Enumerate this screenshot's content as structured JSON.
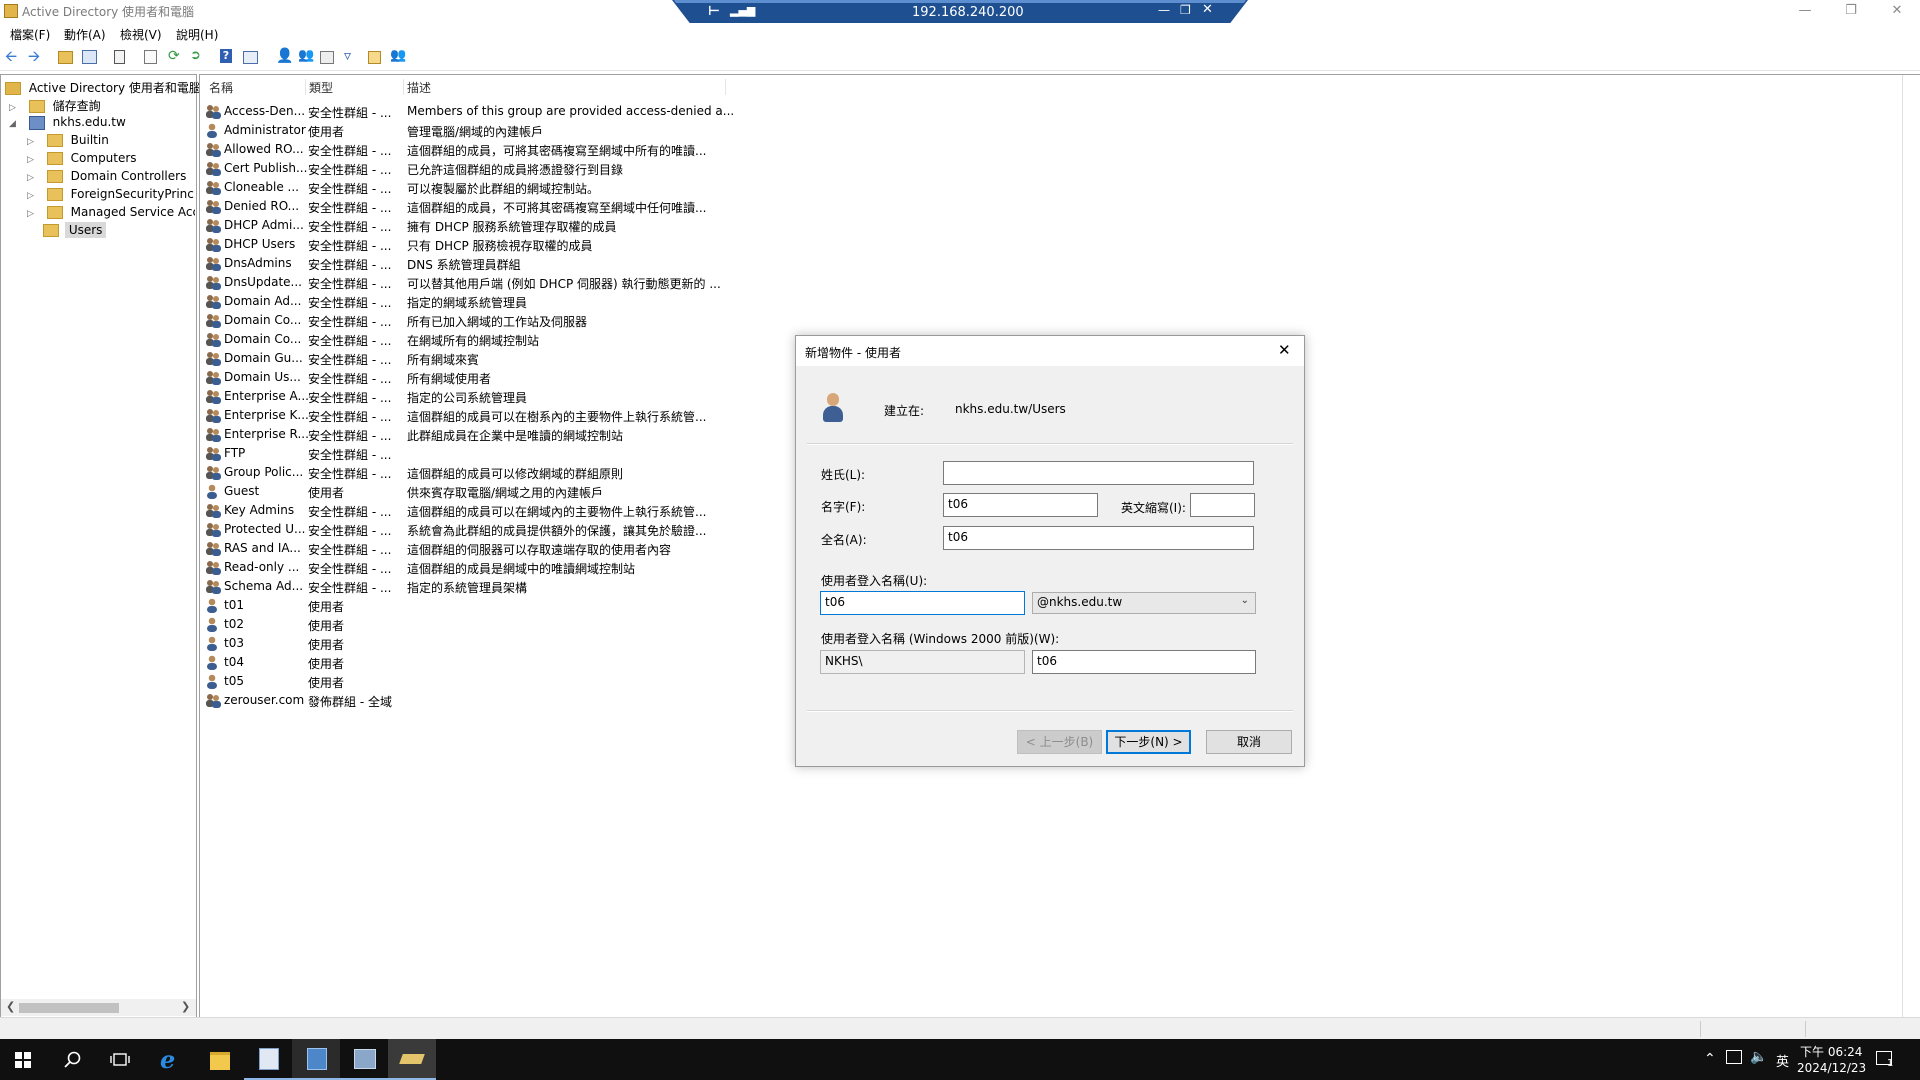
{
  "window": {
    "title": "Active Directory 使用者和電腦"
  },
  "rdp": {
    "ip": "192.168.240.200"
  },
  "menu": [
    "檔案(F)",
    "動作(A)",
    "檢視(V)",
    "說明(H)"
  ],
  "tree": {
    "root": "Active Directory 使用者和電腦",
    "saved_queries": "儲存查詢",
    "domain": "nkhs.edu.tw",
    "children": [
      "Builtin",
      "Computers",
      "Domain Controllers",
      "ForeignSecurityPrincipals",
      "Managed Service Accounts",
      "Users"
    ]
  },
  "list": {
    "headers": [
      "名稱",
      "類型",
      "描述"
    ],
    "rows": [
      {
        "name": "Access-Den...",
        "type": "安全性群組 - ...",
        "desc": "Members of this group are provided access-denied a...",
        "icon": "group"
      },
      {
        "name": "Administrator",
        "type": "使用者",
        "desc": "管理電腦/網域的內建帳戶",
        "icon": "user"
      },
      {
        "name": "Allowed RO...",
        "type": "安全性群組 - ...",
        "desc": "這個群組的成員，可將其密碼複寫至網域中所有的唯讀...",
        "icon": "group"
      },
      {
        "name": "Cert Publish...",
        "type": "安全性群組 - ...",
        "desc": "已允許這個群組的成員將憑證發行到目錄",
        "icon": "group"
      },
      {
        "name": "Cloneable ...",
        "type": "安全性群組 - ...",
        "desc": "可以複製屬於此群組的網域控制站。",
        "icon": "group"
      },
      {
        "name": "Denied RO...",
        "type": "安全性群組 - ...",
        "desc": "這個群組的成員，不可將其密碼複寫至網域中任何唯讀...",
        "icon": "group"
      },
      {
        "name": "DHCP Admi...",
        "type": "安全性群組 - ...",
        "desc": "擁有 DHCP 服務系統管理存取權的成員",
        "icon": "group"
      },
      {
        "name": "DHCP Users",
        "type": "安全性群組 - ...",
        "desc": "只有 DHCP 服務檢視存取權的成員",
        "icon": "group"
      },
      {
        "name": "DnsAdmins",
        "type": "安全性群組 - ...",
        "desc": "DNS 系統管理員群組",
        "icon": "group"
      },
      {
        "name": "DnsUpdate...",
        "type": "安全性群組 - ...",
        "desc": "可以替其他用戶端 (例如 DHCP 伺服器) 執行動態更新的 ...",
        "icon": "group"
      },
      {
        "name": "Domain Ad...",
        "type": "安全性群組 - ...",
        "desc": "指定的網域系統管理員",
        "icon": "group"
      },
      {
        "name": "Domain Co...",
        "type": "安全性群組 - ...",
        "desc": "所有已加入網域的工作站及伺服器",
        "icon": "group"
      },
      {
        "name": "Domain Co...",
        "type": "安全性群組 - ...",
        "desc": "在網域所有的網域控制站",
        "icon": "group"
      },
      {
        "name": "Domain Gu...",
        "type": "安全性群組 - ...",
        "desc": "所有網域來賓",
        "icon": "group"
      },
      {
        "name": "Domain Us...",
        "type": "安全性群組 - ...",
        "desc": "所有網域使用者",
        "icon": "group"
      },
      {
        "name": "Enterprise A...",
        "type": "安全性群組 - ...",
        "desc": "指定的公司系統管理員",
        "icon": "group"
      },
      {
        "name": "Enterprise K...",
        "type": "安全性群組 - ...",
        "desc": "這個群組的成員可以在樹系內的主要物件上執行系統管...",
        "icon": "group"
      },
      {
        "name": "Enterprise R...",
        "type": "安全性群組 - ...",
        "desc": "此群組成員在企業中是唯讀的網域控制站",
        "icon": "group"
      },
      {
        "name": "FTP",
        "type": "安全性群組 - ...",
        "desc": "",
        "icon": "group"
      },
      {
        "name": "Group Polic...",
        "type": "安全性群組 - ...",
        "desc": "這個群組的成員可以修改網域的群組原則",
        "icon": "group"
      },
      {
        "name": "Guest",
        "type": "使用者",
        "desc": "供來賓存取電腦/網域之用的內建帳戶",
        "icon": "user"
      },
      {
        "name": "Key Admins",
        "type": "安全性群組 - ...",
        "desc": "這個群組的成員可以在網域內的主要物件上執行系統管...",
        "icon": "group"
      },
      {
        "name": "Protected U...",
        "type": "安全性群組 - ...",
        "desc": "系統會為此群組的成員提供額外的保護，讓其免於驗證...",
        "icon": "group"
      },
      {
        "name": "RAS and IA...",
        "type": "安全性群組 - ...",
        "desc": "這個群組的伺服器可以存取遠端存取的使用者內容",
        "icon": "group"
      },
      {
        "name": "Read-only ...",
        "type": "安全性群組 - ...",
        "desc": "這個群組的成員是網域中的唯讀網域控制站",
        "icon": "group"
      },
      {
        "name": "Schema Ad...",
        "type": "安全性群組 - ...",
        "desc": "指定的系統管理員架構",
        "icon": "group"
      },
      {
        "name": "t01",
        "type": "使用者",
        "desc": "",
        "icon": "user"
      },
      {
        "name": "t02",
        "type": "使用者",
        "desc": "",
        "icon": "user"
      },
      {
        "name": "t03",
        "type": "使用者",
        "desc": "",
        "icon": "user"
      },
      {
        "name": "t04",
        "type": "使用者",
        "desc": "",
        "icon": "user"
      },
      {
        "name": "t05",
        "type": "使用者",
        "desc": "",
        "icon": "user"
      },
      {
        "name": "zerouser.com",
        "type": "發佈群組 - 全域",
        "desc": "",
        "icon": "group"
      }
    ]
  },
  "dialog": {
    "title": "新增物件 - 使用者",
    "create_in_label": "建立在:",
    "create_in_value": "nkhs.edu.tw/Users",
    "last_name_label": "姓氏(L):",
    "last_name_value": "",
    "first_name_label": "名字(F):",
    "first_name_value": "t06",
    "initials_label": "英文縮寫(I):",
    "initials_value": "",
    "full_name_label": "全名(A):",
    "full_name_value": "t06",
    "logon_label": "使用者登入名稱(U):",
    "logon_value": "t06",
    "upn_suffix": "@nkhs.edu.tw",
    "pre2000_label": "使用者登入名稱 (Windows 2000 前版)(W):",
    "pre2000_domain": "NKHS\\",
    "pre2000_value": "t06",
    "back_button": "< 上一步(B)",
    "next_button": "下一步(N) >",
    "cancel_button": "取消"
  },
  "taskbar": {
    "ime": "英",
    "time": "下午 06:24",
    "date": "2024/12/23",
    "notification_count": "1"
  },
  "colors": {
    "accent": "#0078d7",
    "rdp_bar": "#1e4f91",
    "taskbar": "#101010"
  }
}
